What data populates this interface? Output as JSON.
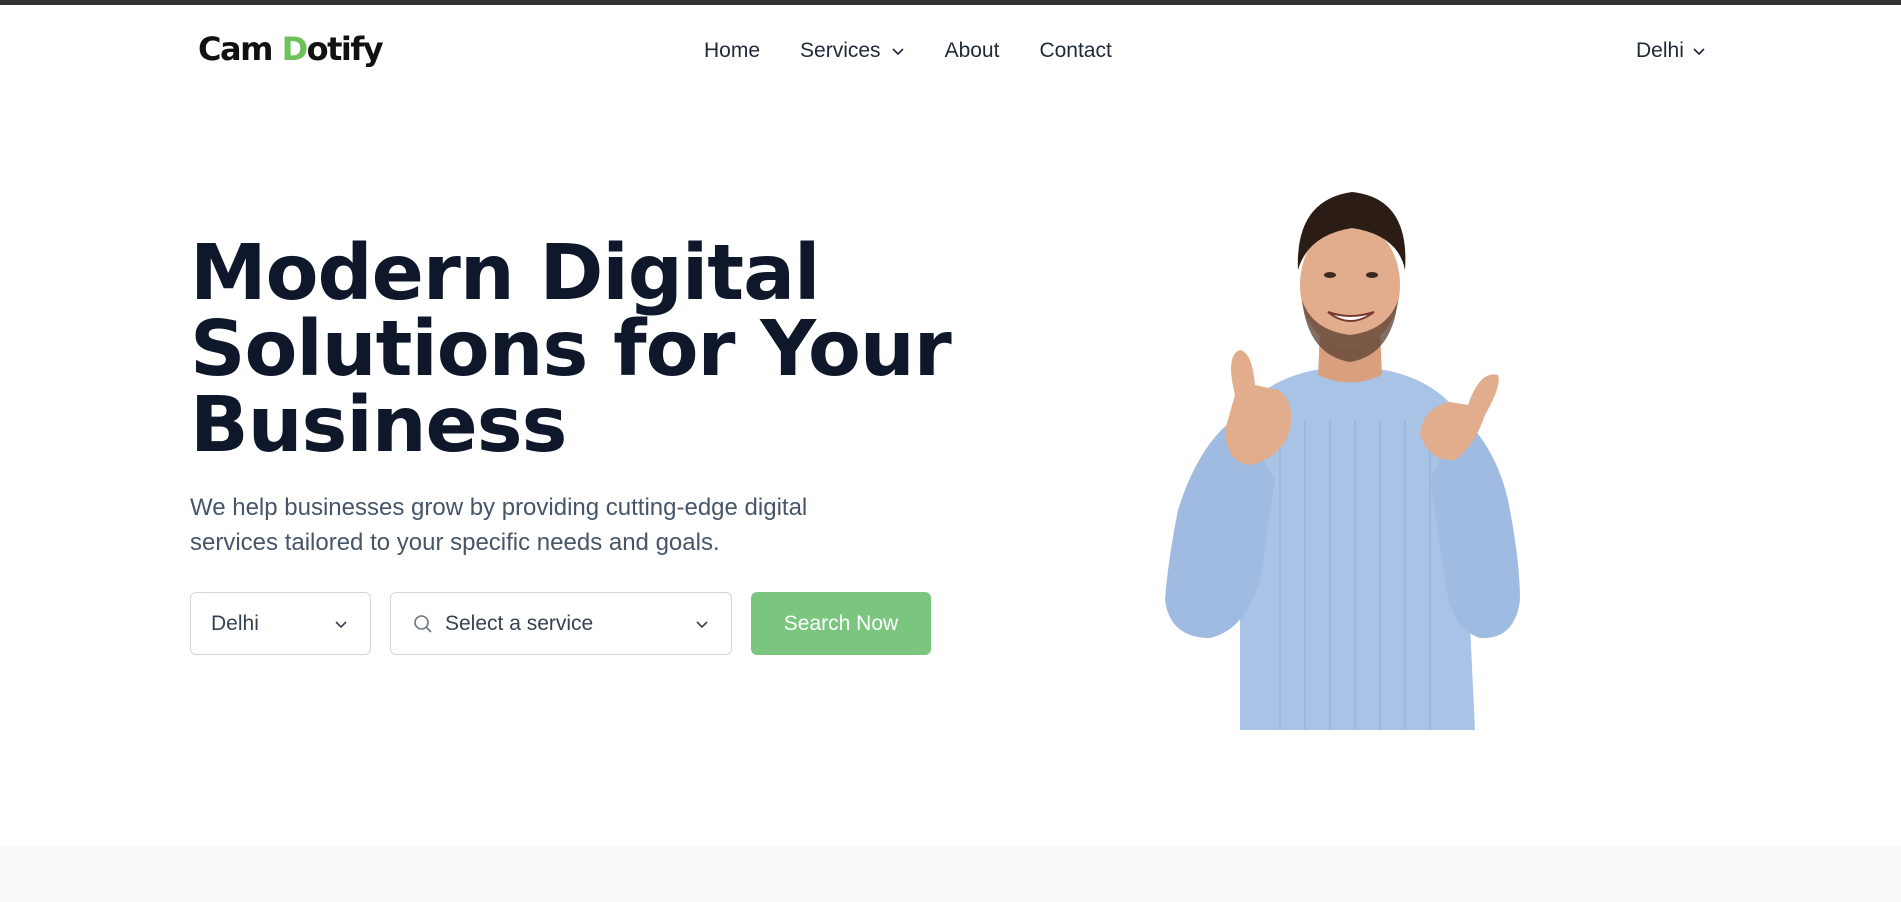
{
  "brand": {
    "logo_text_1": "Cam ",
    "logo_text_2": "D",
    "logo_text_3": "otify",
    "accent_color": "#6cc15b"
  },
  "nav": {
    "items": [
      {
        "label": "Home"
      },
      {
        "label": "Services",
        "has_dropdown": true
      },
      {
        "label": "About"
      },
      {
        "label": "Contact"
      }
    ],
    "city_label": "Delhi"
  },
  "hero": {
    "title": "Modern Digital Solutions for Your Business",
    "subtitle": "We help businesses grow by providing cutting-edge digital services tailored to your specific needs and goals.",
    "city_value": "Delhi",
    "service_placeholder": "Select a service",
    "search_label": "Search Now",
    "button_color": "#7bc67e"
  }
}
